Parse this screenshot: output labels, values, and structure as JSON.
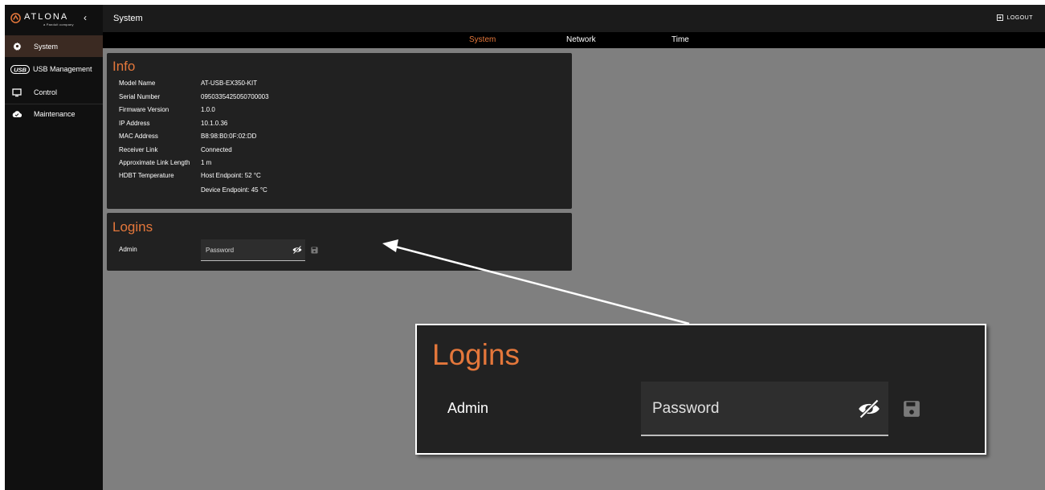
{
  "brand": {
    "name": "ATLONA",
    "tagline": "a Panduit company"
  },
  "header": {
    "title": "System",
    "logout_label": "LOGOUT"
  },
  "sidebar": {
    "items": [
      {
        "label": "System",
        "icon": "gear-icon",
        "active": true
      },
      {
        "label": "USB Management",
        "icon": "usb-icon",
        "active": false
      },
      {
        "label": "Control",
        "icon": "monitor-icon",
        "active": false
      },
      {
        "label": "Maintenance",
        "icon": "cloud-check-icon",
        "active": false
      }
    ]
  },
  "tabs": [
    {
      "label": "System",
      "active": true
    },
    {
      "label": "Network",
      "active": false
    },
    {
      "label": "Time",
      "active": false
    }
  ],
  "info": {
    "title": "Info",
    "rows": [
      {
        "label": "Model Name",
        "value": "AT-USB-EX350-KIT"
      },
      {
        "label": "Serial Number",
        "value": "0950335425050700003"
      },
      {
        "label": "Firmware Version",
        "value": "1.0.0"
      },
      {
        "label": "IP Address",
        "value": "10.1.0.36"
      },
      {
        "label": "MAC Address",
        "value": "B8:98:B0:0F:02:DD"
      },
      {
        "label": "Receiver Link",
        "value": "Connected"
      },
      {
        "label": "Approximate Link Length",
        "value": "1 m"
      },
      {
        "label": "HDBT Temperature",
        "value": "Host Endpoint: 52 °C"
      },
      {
        "label": "",
        "value": "Device Endpoint: 45 °C"
      }
    ]
  },
  "logins": {
    "title": "Logins",
    "user_label": "Admin",
    "password_placeholder": "Password",
    "password_value": ""
  },
  "zoom": {
    "title": "Logins",
    "user_label": "Admin",
    "password_placeholder": "Password"
  },
  "colors": {
    "accent": "#e4773b",
    "background": "#7f7f7f",
    "panel": "#212121",
    "sidebar": "#101010",
    "active_nav": "#3b2a22"
  }
}
